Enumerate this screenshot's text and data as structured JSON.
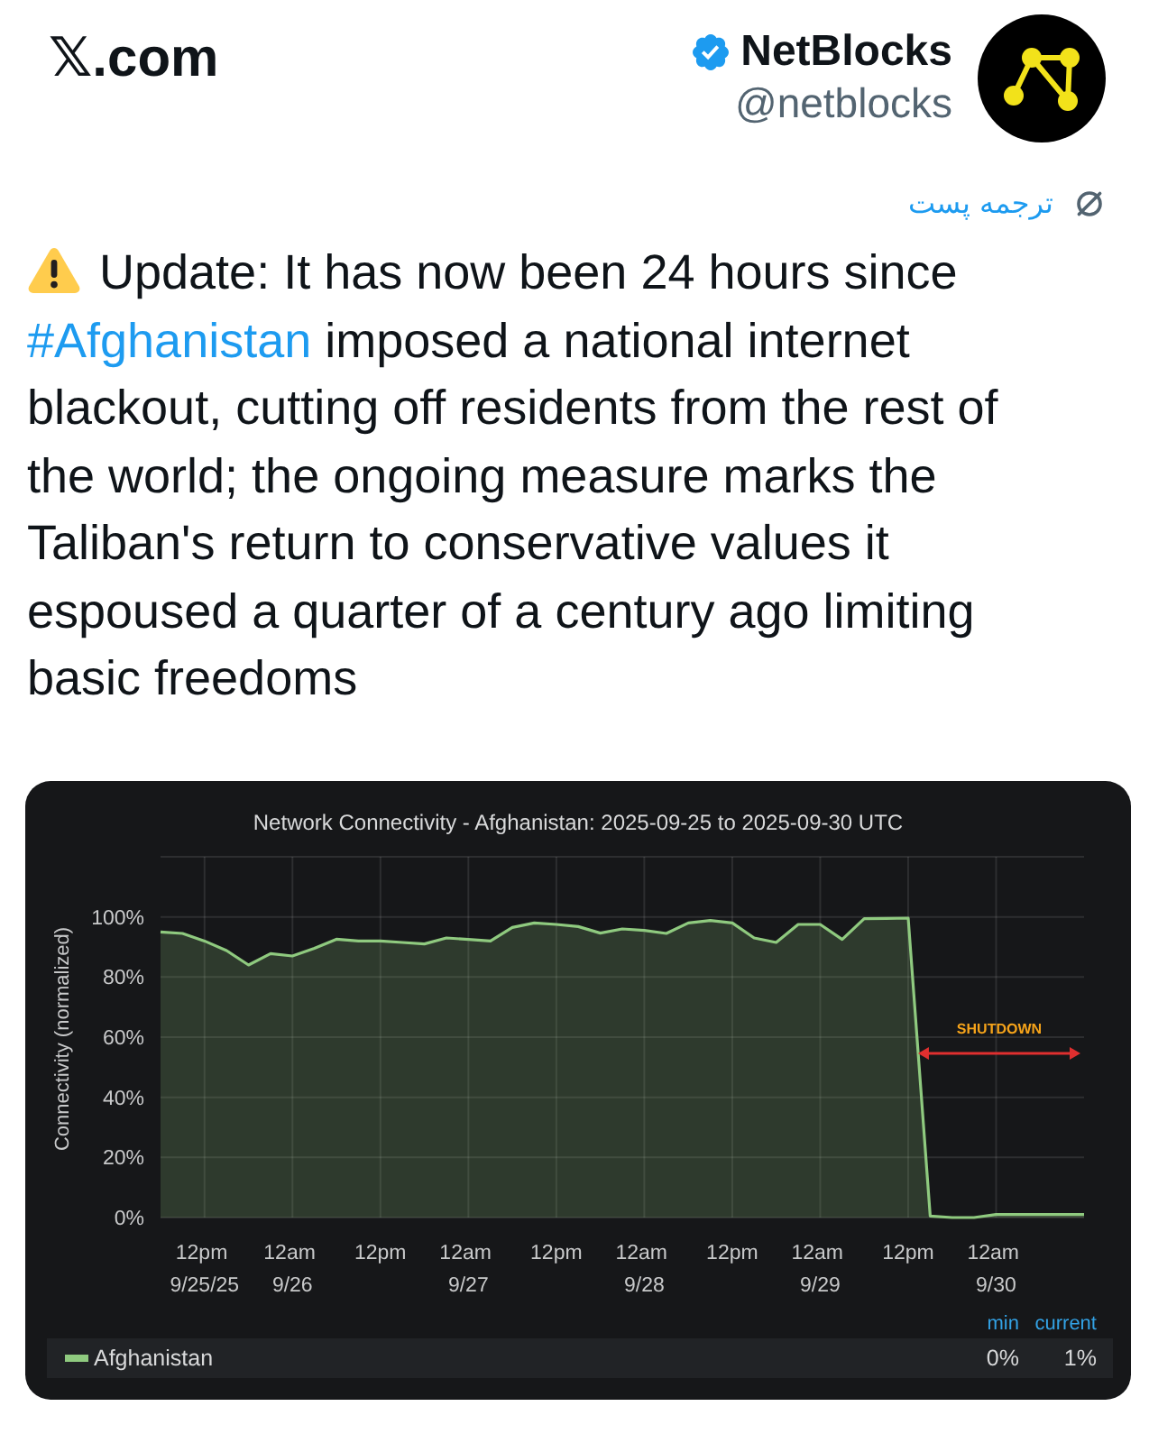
{
  "header": {
    "site": "𝕏.com",
    "author": {
      "name": "NetBlocks",
      "handle": "@netblocks",
      "verified": true
    }
  },
  "translate": {
    "label": "ترجمه پست"
  },
  "post": {
    "segments": [
      {
        "kind": "text",
        "text": "Update: It has now been 24 hours since "
      },
      {
        "kind": "hashtag",
        "text": "#Afghanistan"
      },
      {
        "kind": "text",
        "text": " imposed a national internet blackout, cutting off residents from the rest of the world; the ongoing measure marks the Taliban's return to conservative values it espoused a quarter of a century ago limiting basic freedoms"
      }
    ]
  },
  "chart": {
    "chart_data": {
      "type": "area",
      "title": "Network Connectivity - Afghanistan: 2025-09-25 to 2025-09-30 UTC",
      "ylabel": "Connectivity (normalized)",
      "categories": [
        null,
        null,
        "12pm\n9/25/25",
        null,
        null,
        null,
        "12am\n9/26",
        null,
        null,
        null,
        "12pm",
        null,
        null,
        null,
        "12am\n9/27",
        null,
        null,
        null,
        "12pm",
        null,
        null,
        null,
        "12am\n9/28",
        null,
        null,
        null,
        "12pm",
        null,
        null,
        null,
        "12am\n9/29",
        null,
        null,
        null,
        "12pm",
        null,
        null,
        null,
        "12am\n9/30",
        null,
        null,
        null,
        null
      ],
      "series": [
        {
          "name": "Afghanistan",
          "color": "#8fca7f",
          "values": [
            95,
            94.5,
            92,
            88.8,
            84,
            87.8,
            87,
            89.5,
            92.6,
            92,
            92,
            91.5,
            91,
            93,
            92.5,
            92,
            96.5,
            98,
            97.5,
            96.8,
            94.6,
            96,
            95.5,
            94.5,
            98,
            98.8,
            98,
            93,
            91.5,
            97.5,
            97.5,
            92.5,
            99.4,
            99.5,
            99.6,
            0.5,
            0,
            0,
            1,
            1,
            1,
            1,
            1
          ]
        }
      ],
      "ylim": [
        0,
        120
      ],
      "yticks": [
        {
          "value": 0,
          "label": "0%"
        },
        {
          "value": 20,
          "label": "20%"
        },
        {
          "value": 40,
          "label": "40%"
        },
        {
          "value": 60,
          "label": "60%"
        },
        {
          "value": 80,
          "label": "80%"
        },
        {
          "value": 100,
          "label": "100%"
        }
      ],
      "grid": true,
      "annotations": [
        "SHUTDOWN"
      ]
    },
    "legend": {
      "headers": [
        "min",
        "current"
      ],
      "rows": [
        {
          "values": [
            "0%",
            "1%"
          ]
        }
      ]
    }
  }
}
